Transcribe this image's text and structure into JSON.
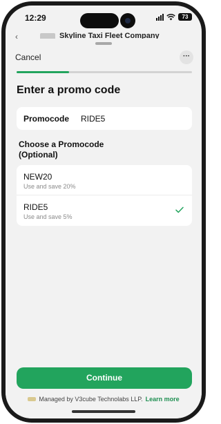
{
  "status_bar": {
    "time": "12:29",
    "battery": "73"
  },
  "background_header": {
    "title": "Skyline Taxi Fleet Company"
  },
  "sheet": {
    "cancel_label": "Cancel",
    "more_label": "···",
    "progress": 0.3,
    "title": "Enter a promo code"
  },
  "promo_field": {
    "label": "Promocode",
    "value": "RIDE5"
  },
  "promo_section": {
    "title": "Choose a Promocode (Optional)",
    "items": [
      {
        "code": "NEW20",
        "description": "Use and save 20%",
        "selected": false
      },
      {
        "code": "RIDE5",
        "description": "Use and save 5%",
        "selected": true
      }
    ]
  },
  "continue_label": "Continue",
  "footer": {
    "text": "Managed by V3cube Technolabs LLP.",
    "link": "Learn more"
  },
  "colors": {
    "accent": "#22a45d",
    "link": "#1f8f52"
  },
  "icons": {
    "check": "check-icon",
    "more": "more-horizontal-icon",
    "back": "chevron-left-icon"
  }
}
